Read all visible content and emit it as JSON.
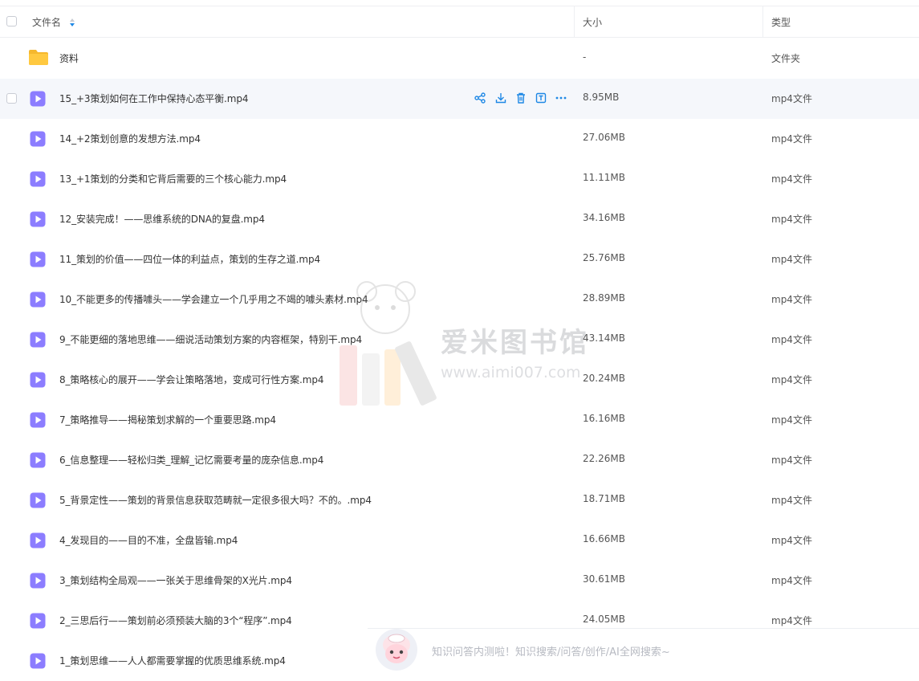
{
  "header": {
    "name_label": "文件名",
    "size_label": "大小",
    "type_label": "类型"
  },
  "folder": {
    "name": "资料",
    "size": "-",
    "type": "文件夹"
  },
  "files": [
    {
      "name": "15_+3策划如何在工作中保持心态平衡.mp4",
      "size": "8.95MB",
      "type": "mp4文件"
    },
    {
      "name": "14_+2策划创意的发想方法.mp4",
      "size": "27.06MB",
      "type": "mp4文件"
    },
    {
      "name": "13_+1策划的分类和它背后需要的三个核心能力.mp4",
      "size": "11.11MB",
      "type": "mp4文件"
    },
    {
      "name": "12_安装完成！——思维系统的DNA的复盘.mp4",
      "size": "34.16MB",
      "type": "mp4文件"
    },
    {
      "name": "11_策划的价值——四位一体的利益点，策划的生存之道.mp4",
      "size": "25.76MB",
      "type": "mp4文件"
    },
    {
      "name": "10_不能更多的传播噱头——学会建立一个几乎用之不竭的噱头素材.mp4",
      "size": "28.89MB",
      "type": "mp4文件"
    },
    {
      "name": "9_不能更细的落地思维——细说活动策划方案的内容框架，特别干.mp4",
      "size": "43.14MB",
      "type": "mp4文件"
    },
    {
      "name": "8_策略核心的展开——学会让策略落地，变成可行性方案.mp4",
      "size": "20.24MB",
      "type": "mp4文件"
    },
    {
      "name": "7_策略推导——揭秘策划求解的一个重要思路.mp4",
      "size": "16.16MB",
      "type": "mp4文件"
    },
    {
      "name": "6_信息整理——轻松归类_理解_记忆需要考量的庞杂信息.mp4",
      "size": "22.26MB",
      "type": "mp4文件"
    },
    {
      "name": "5_背景定性——策划的背景信息获取范畴就一定很多很大吗？不的。.mp4",
      "size": "18.71MB",
      "type": "mp4文件"
    },
    {
      "name": "4_发现目的——目的不准，全盘皆输.mp4",
      "size": "16.66MB",
      "type": "mp4文件"
    },
    {
      "name": "3_策划结构全局观——一张关于思维骨架的X光片.mp4",
      "size": "30.61MB",
      "type": "mp4文件"
    },
    {
      "name": "2_三思后行——策划前必须预装大脑的3个“程序”.mp4",
      "size": "24.05MB",
      "type": "mp4文件"
    },
    {
      "name": "1_策划思维——人人都需要掌握的优质思维系统.mp4",
      "size": "",
      "type": ""
    }
  ],
  "hovered_row_index": 0,
  "row_actions": [
    "share-icon",
    "download-icon",
    "delete-icon",
    "rename-icon",
    "more-icon"
  ],
  "watermark": {
    "title": "爱米图书馆",
    "url": "www.aimi007.com"
  },
  "ai_bar": {
    "text": "知识问答内测啦！知识搜索/问答/创作/AI全网搜索~"
  },
  "colors": {
    "accent": "#1e88e5",
    "video_icon": "#8c7dff",
    "folder_icon": "#ffc533",
    "hover_bg": "#f5f7fb"
  }
}
